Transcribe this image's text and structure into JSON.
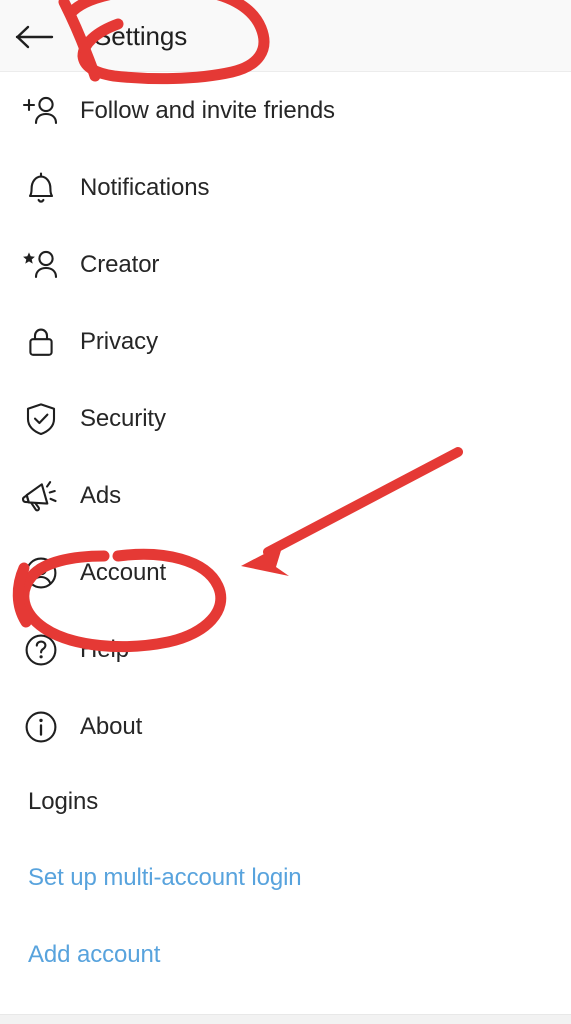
{
  "app": {
    "screen_title": "Settings",
    "background_color": "#ffffff",
    "text_color": "#262626",
    "link_color": "#58a3dd",
    "annotation_color": "#e53935"
  },
  "header": {
    "back_icon": "back-arrow-icon",
    "title": "Settings"
  },
  "menu": {
    "items": [
      {
        "label": "Follow and invite friends",
        "icon": "person-add-icon"
      },
      {
        "label": "Notifications",
        "icon": "bell-icon"
      },
      {
        "label": "Creator",
        "icon": "person-star-icon"
      },
      {
        "label": "Privacy",
        "icon": "lock-icon"
      },
      {
        "label": "Security",
        "icon": "shield-check-icon"
      },
      {
        "label": "Ads",
        "icon": "megaphone-icon"
      },
      {
        "label": "Account",
        "icon": "person-circle-icon"
      },
      {
        "label": "Help",
        "icon": "question-circle-icon"
      },
      {
        "label": "About",
        "icon": "info-circle-icon"
      }
    ]
  },
  "logins_section": {
    "heading": "Logins",
    "links": [
      {
        "label": "Set up multi-account login"
      },
      {
        "label": "Add account"
      }
    ]
  },
  "annotations": {
    "title_circle": {
      "name": "red-circle-around-settings-title",
      "color": "#e53935"
    },
    "account_circle": {
      "name": "red-circle-around-account",
      "color": "#e53935"
    },
    "pointer_arrow": {
      "name": "red-arrow-pointing-at-account",
      "color": "#e53935"
    }
  }
}
